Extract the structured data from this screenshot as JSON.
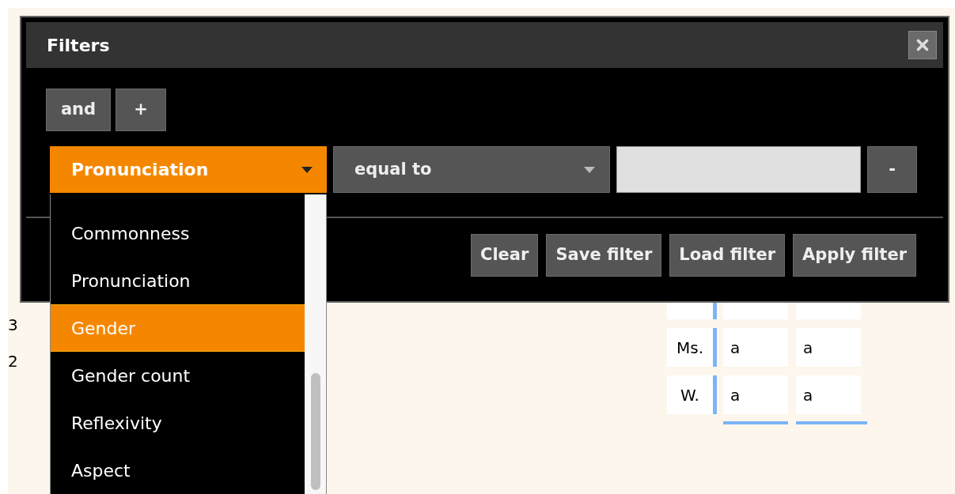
{
  "background": {
    "row_labels": [
      "3",
      "2"
    ],
    "table": {
      "rows": [
        {
          "label": "Ms.",
          "cells": [
            "a",
            "a"
          ]
        },
        {
          "label": "W.",
          "cells": [
            "a",
            "a"
          ]
        }
      ]
    }
  },
  "dialog": {
    "title": "Filters",
    "logic_button": "and",
    "add_button": "+",
    "condition": {
      "field": "Pronunciation",
      "operator": "equal to",
      "remove_button": "-"
    },
    "field_options": [
      {
        "label": "Commonness",
        "selected": false
      },
      {
        "label": "Pronunciation",
        "selected": false
      },
      {
        "label": "Gender",
        "selected": true
      },
      {
        "label": "Gender count",
        "selected": false
      },
      {
        "label": "Reflexivity",
        "selected": false
      },
      {
        "label": "Aspect",
        "selected": false
      }
    ],
    "actions": [
      "Clear",
      "Save filter",
      "Load filter",
      "Apply filter"
    ]
  }
}
